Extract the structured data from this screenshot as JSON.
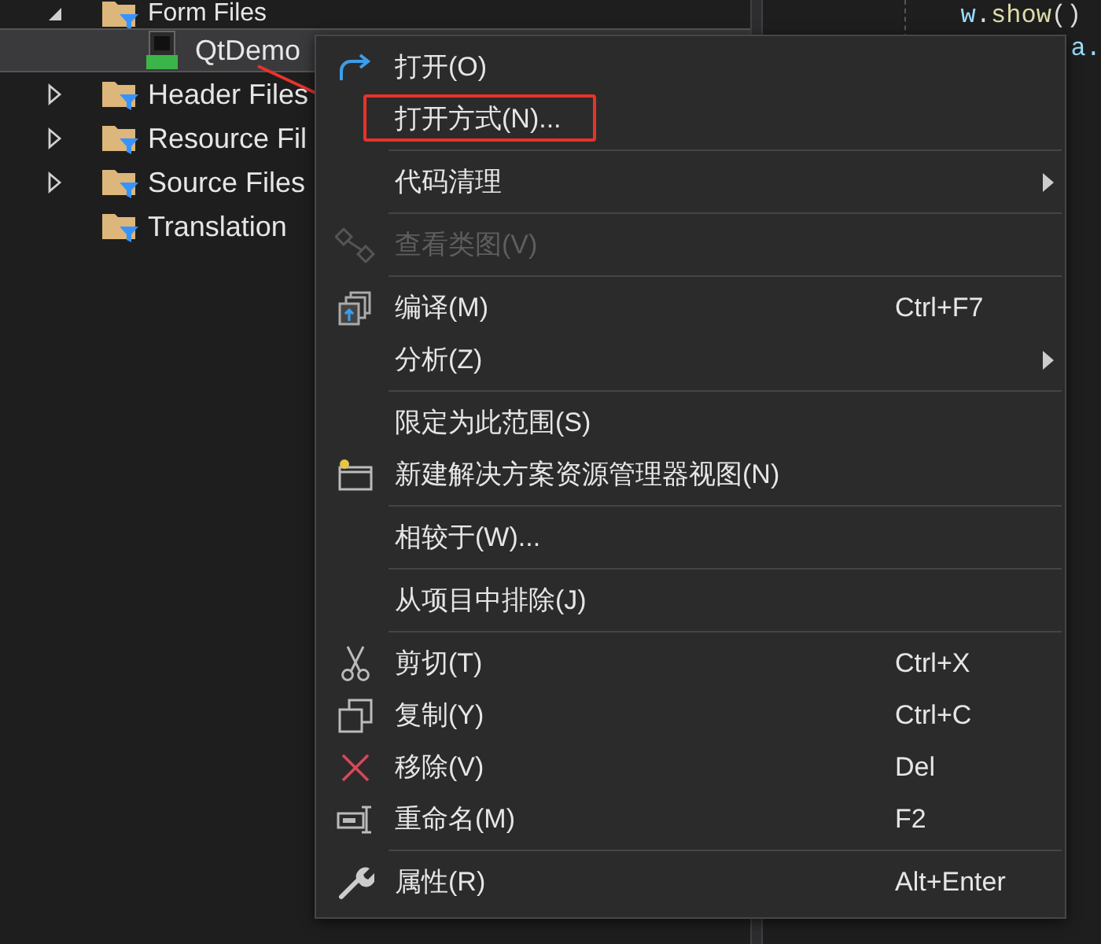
{
  "tree": [
    {
      "label": "Form Files",
      "kind": "folder",
      "expanded": true,
      "selected": false
    },
    {
      "label": "QtDemo",
      "kind": "ui-file",
      "selected": true
    },
    {
      "label": "Header Files",
      "kind": "folder",
      "expanded": false,
      "selected": false
    },
    {
      "label": "Resource Fil",
      "kind": "folder",
      "expanded": false,
      "selected": false
    },
    {
      "label": "Source Files",
      "kind": "folder",
      "expanded": false,
      "selected": false
    },
    {
      "label": "Translation",
      "kind": "folder",
      "selected": false
    }
  ],
  "editor": {
    "lines": [
      [
        {
          "text": "w",
          "kind": "var"
        },
        {
          "text": ".",
          "kind": "punct"
        },
        {
          "text": "show",
          "kind": "fn"
        },
        {
          "text": "()",
          "kind": "punct"
        }
      ],
      [
        {
          "text": "a.",
          "kind": "var"
        }
      ]
    ]
  },
  "context_menu": {
    "items": [
      {
        "kind": "item",
        "label": "打开(O)",
        "disabled": false,
        "submenu": false,
        "highlighted": false
      },
      {
        "kind": "item",
        "label": "打开方式(N)...",
        "disabled": false,
        "submenu": false,
        "highlighted": true
      },
      {
        "kind": "separator"
      },
      {
        "kind": "item",
        "label": "代码清理",
        "disabled": false,
        "submenu": true,
        "highlighted": false
      },
      {
        "kind": "separator"
      },
      {
        "kind": "item",
        "label": "查看类图(V)",
        "disabled": true,
        "submenu": false,
        "highlighted": false
      },
      {
        "kind": "separator"
      },
      {
        "kind": "item",
        "label": "编译(M)",
        "shortcut": "Ctrl+F7",
        "disabled": false,
        "submenu": false,
        "highlighted": false
      },
      {
        "kind": "item",
        "label": "分析(Z)",
        "disabled": false,
        "submenu": true,
        "highlighted": false
      },
      {
        "kind": "separator"
      },
      {
        "kind": "item",
        "label": "限定为此范围(S)",
        "disabled": false,
        "submenu": false,
        "highlighted": false
      },
      {
        "kind": "item",
        "label": "新建解决方案资源管理器视图(N)",
        "disabled": false,
        "submenu": false,
        "highlighted": false
      },
      {
        "kind": "separator"
      },
      {
        "kind": "item",
        "label": "相较于(W)...",
        "disabled": false,
        "submenu": false,
        "highlighted": false
      },
      {
        "kind": "separator"
      },
      {
        "kind": "item",
        "label": "从项目中排除(J)",
        "disabled": false,
        "submenu": false,
        "highlighted": false
      },
      {
        "kind": "separator"
      },
      {
        "kind": "item",
        "label": "剪切(T)",
        "shortcut": "Ctrl+X",
        "disabled": false,
        "submenu": false,
        "highlighted": false
      },
      {
        "kind": "item",
        "label": "复制(Y)",
        "shortcut": "Ctrl+C",
        "disabled": false,
        "submenu": false,
        "highlighted": false
      },
      {
        "kind": "item",
        "label": "移除(V)",
        "shortcut": "Del",
        "disabled": false,
        "submenu": false,
        "highlighted": false
      },
      {
        "kind": "item",
        "label": "重命名(M)",
        "shortcut": "F2",
        "disabled": false,
        "submenu": false,
        "highlighted": false
      },
      {
        "kind": "separator"
      },
      {
        "kind": "item",
        "label": "属性(R)",
        "shortcut": "Alt+Enter",
        "disabled": false,
        "submenu": false,
        "highlighted": false
      }
    ]
  }
}
